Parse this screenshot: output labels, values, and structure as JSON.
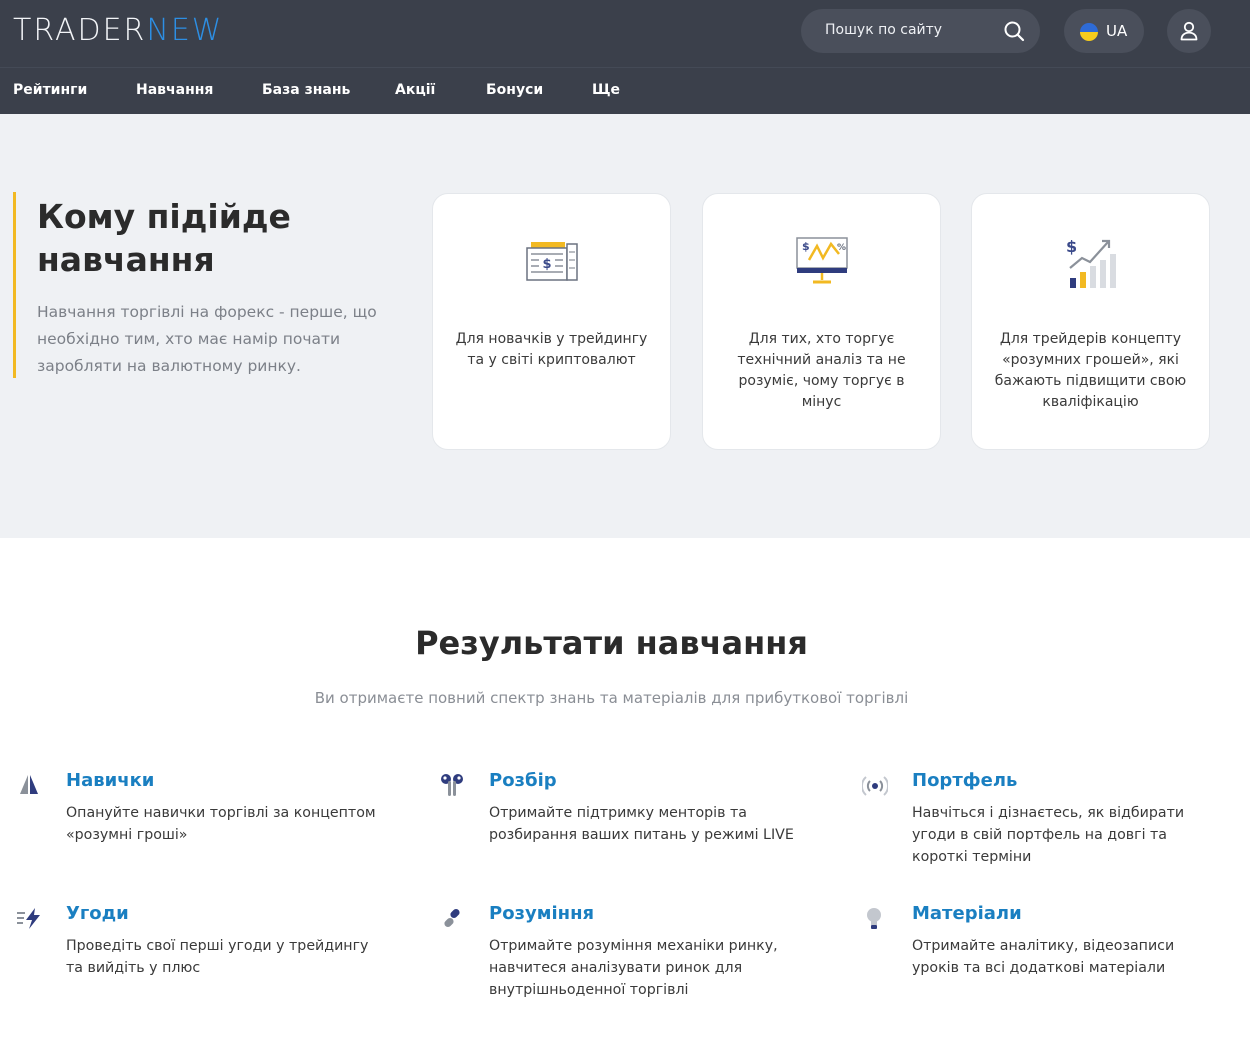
{
  "header": {
    "logo_part1": "TRADER",
    "logo_part2": "NEW",
    "search_placeholder": "Пошук по сайту",
    "lang": "UA"
  },
  "nav": [
    "Рейтинги",
    "Навчання",
    "База знань",
    "Акції",
    "Бонуси",
    "Ще"
  ],
  "hero": {
    "title": "Кому підійде навчання",
    "description": "Навчання торгівлі на форекс - перше, що необхідно тим, хто має намір почати заробляти на валютному ринку.",
    "cards": [
      {
        "icon": "money-stack-icon",
        "text": "Для новачків у трейдингу та у світі криптовалют"
      },
      {
        "icon": "chart-monitor-icon",
        "text": "Для тих, хто торгує технічний аналіз та не розуміє, чому торгує в мінус"
      },
      {
        "icon": "growth-chart-icon",
        "text": "Для трейдерів концепту «розумних грошей», які бажають підвищити свою кваліфікацію"
      }
    ]
  },
  "results": {
    "title": "Результати навчання",
    "subtitle": "Ви отримаєте повний спектр знань та матеріалів для прибуткової торгівлі",
    "items": [
      {
        "icon": "sail-icon",
        "title": "Навички",
        "text": "Опануйте навички торгівлі за концептом «розумні гроші»"
      },
      {
        "icon": "earbuds-icon",
        "title": "Розбір",
        "text": "Отримайте підтримку менторів та розбирання ваших питань у режимі LIVE"
      },
      {
        "icon": "broadcast-icon",
        "title": "Портфель",
        "text": "Навчіться і дізнаєтесь, як відбирати угоди в свій портфель на довгі та короткі терміни"
      },
      {
        "icon": "lightning-icon",
        "title": "Угоди",
        "text": "Проведіть свої перші угоди у трейдингу та вийдіть у плюс"
      },
      {
        "icon": "link-icon",
        "title": "Розуміння",
        "text": "Отримайте розуміння механіки ринку, навчитеся аналізувати ринок для внутрішньоденної торгівлі"
      },
      {
        "icon": "lightbulb-icon",
        "title": "Матеріали",
        "text": "Отримайте аналітику, відеозаписи уроків та всі додаткові матеріали"
      }
    ]
  },
  "colors": {
    "header_bg": "#3b404b",
    "accent_blue": "#1a7fc1",
    "accent_yellow": "#f2b922",
    "hero_bg": "#eff1f4"
  }
}
